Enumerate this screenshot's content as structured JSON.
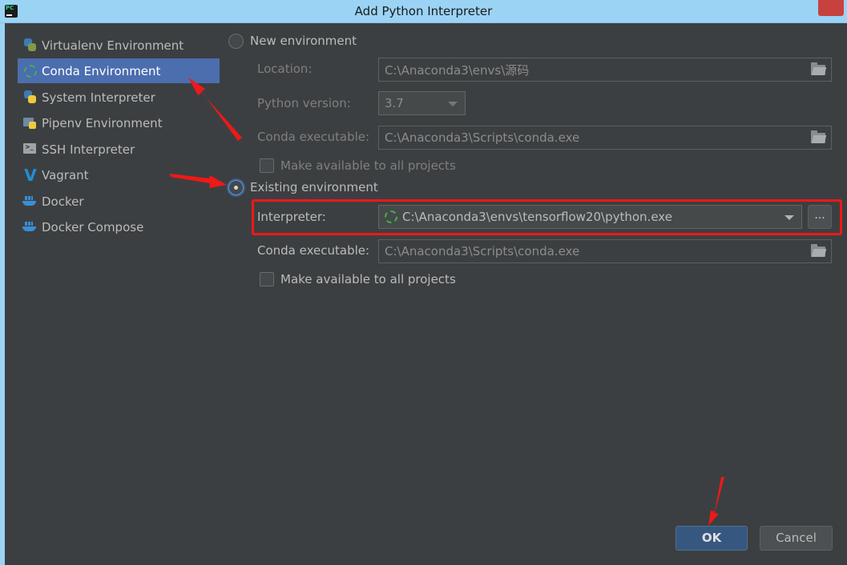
{
  "window": {
    "title": "Add Python Interpreter"
  },
  "sidebar": {
    "items": [
      {
        "label": "Virtualenv Environment",
        "icon": "virtualenv-icon"
      },
      {
        "label": "Conda Environment",
        "icon": "conda-icon",
        "selected": true
      },
      {
        "label": "System Interpreter",
        "icon": "python-icon"
      },
      {
        "label": "Pipenv Environment",
        "icon": "pipenv-icon"
      },
      {
        "label": "SSH Interpreter",
        "icon": "ssh-icon"
      },
      {
        "label": "Vagrant",
        "icon": "vagrant-icon",
        "glyph": "V"
      },
      {
        "label": "Docker",
        "icon": "docker-icon"
      },
      {
        "label": "Docker Compose",
        "icon": "docker-compose-icon"
      }
    ]
  },
  "new_env": {
    "radio_label": "New environment",
    "selected": false,
    "location_label": "Location:",
    "location_value": "C:\\Anaconda3\\envs\\源码",
    "python_version_label": "Python version:",
    "python_version_value": "3.7",
    "conda_exec_label": "Conda executable:",
    "conda_exec_value": "C:\\Anaconda3\\Scripts\\conda.exe",
    "make_available_label": "Make available to all projects"
  },
  "existing_env": {
    "radio_label": "Existing environment",
    "selected": true,
    "interpreter_label": "Interpreter:",
    "interpreter_value": "C:\\Anaconda3\\envs\\tensorflow20\\python.exe",
    "browse_label": "...",
    "conda_exec_label": "Conda executable:",
    "conda_exec_value": "C:\\Anaconda3\\Scripts\\conda.exe",
    "make_available_label": "Make available to all projects"
  },
  "buttons": {
    "ok_label": "OK",
    "cancel_label": "Cancel"
  },
  "colors": {
    "selection": "#4b6eaf",
    "annotation": "#f01818",
    "ok_button": "#365880"
  }
}
